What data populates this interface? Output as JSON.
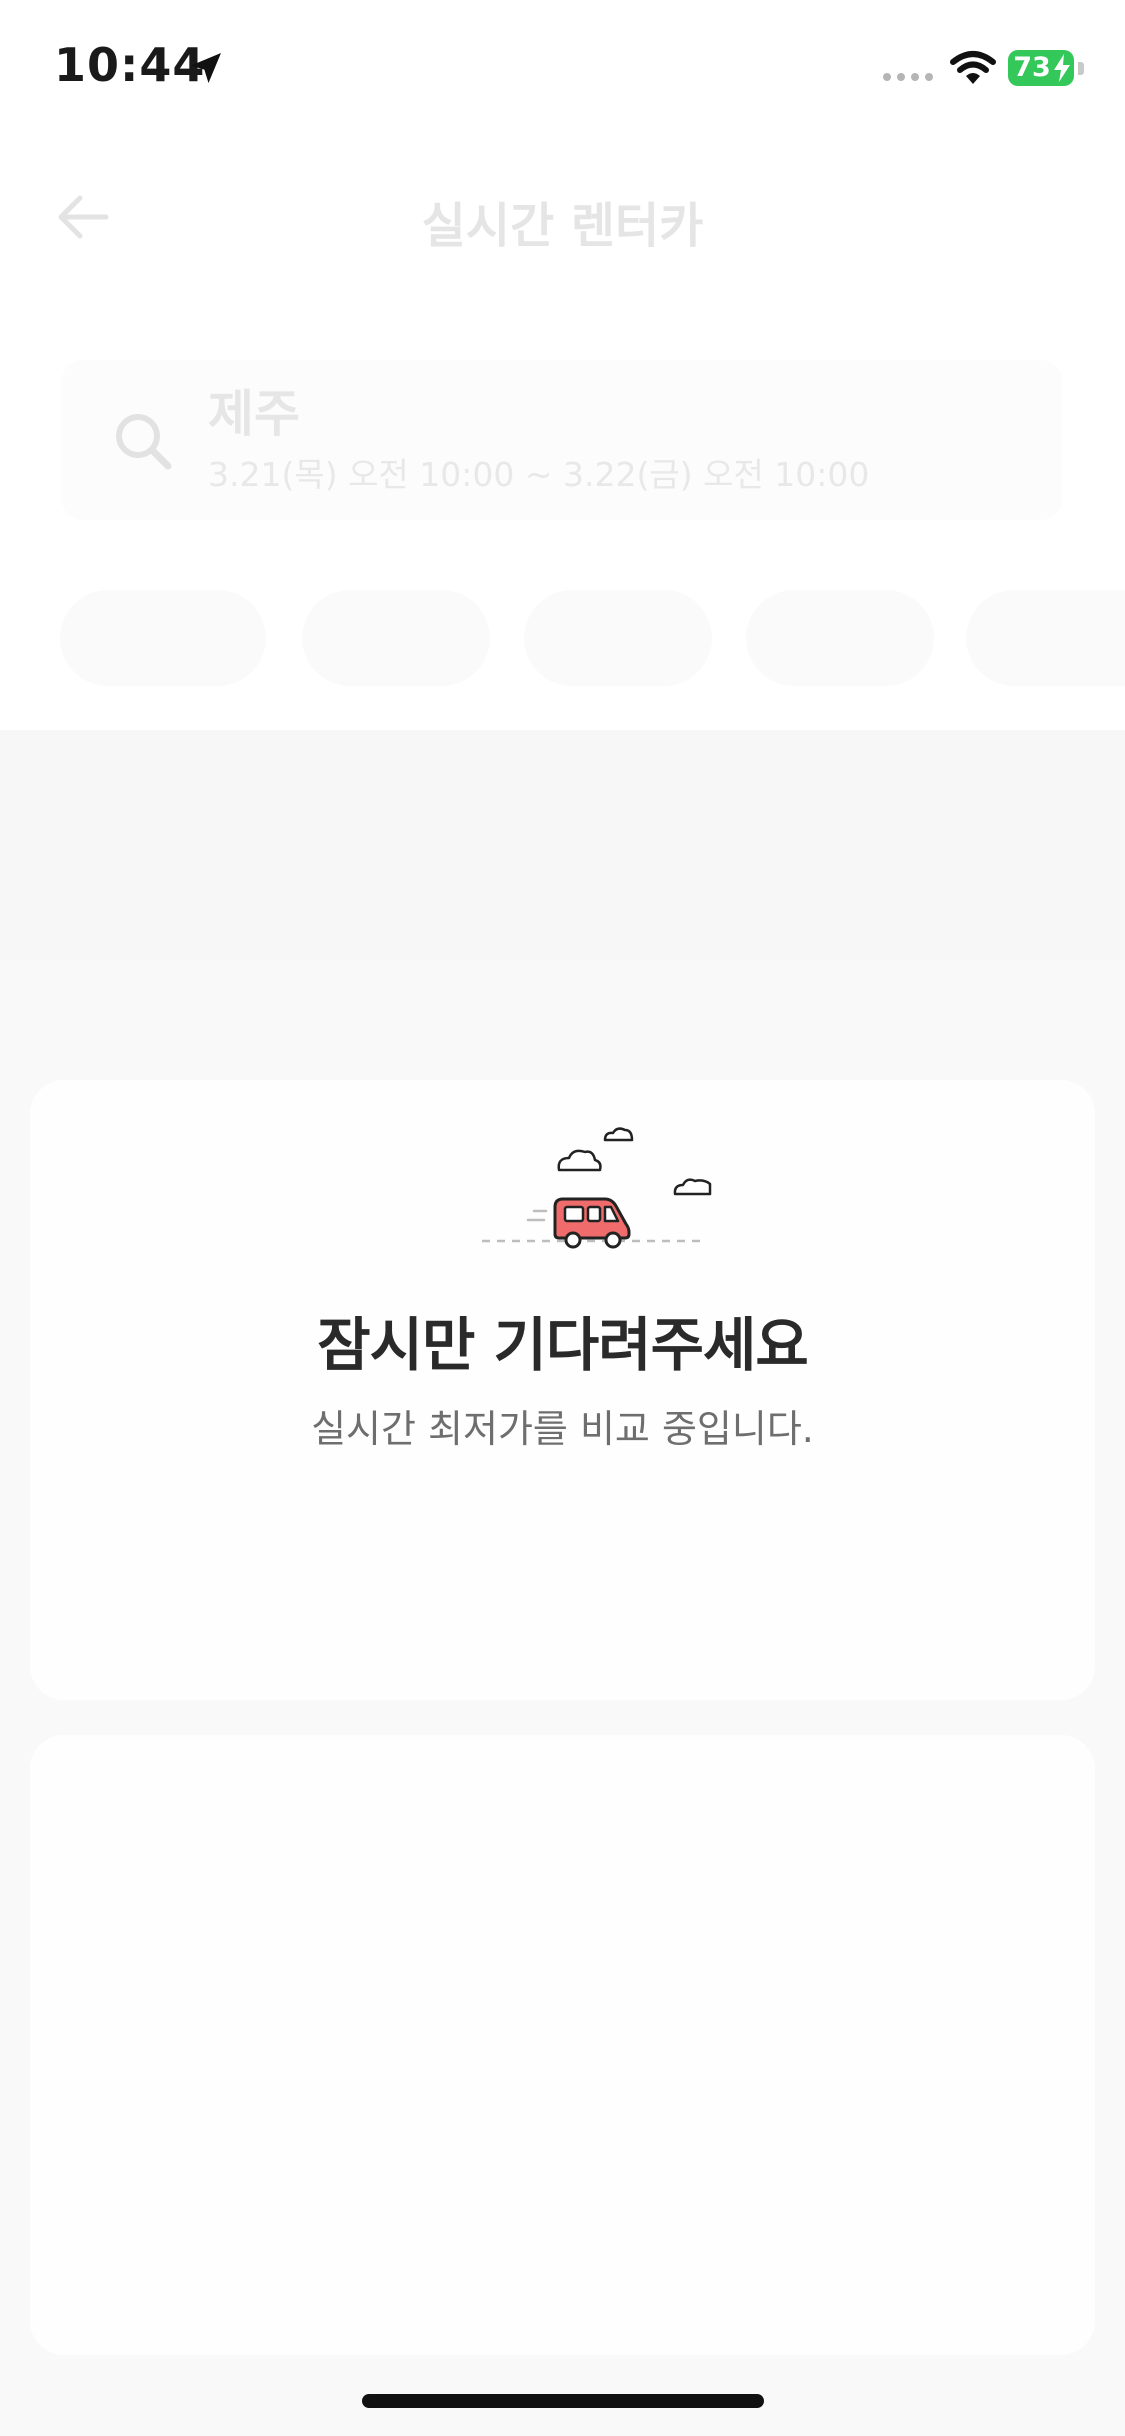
{
  "status_bar": {
    "time": "10:44",
    "battery_percent": "73",
    "icons": [
      "location-arrow-icon",
      "cellular-signal-icon",
      "wifi-icon",
      "battery-charging-icon"
    ],
    "battery_color": "#34c759"
  },
  "header": {
    "title": "실시간 렌터카",
    "back_icon": "arrow-left-icon"
  },
  "search": {
    "location": "제주",
    "dates": "3.21(목) 오전 10:00 ~ 3.22(금) 오전 10:00",
    "icon": "search-icon"
  },
  "loading": {
    "title": "잠시만 기다려주세요",
    "subtitle": "실시간 최저가를 비교 중입니다.",
    "illustration": "moving-van-illustration",
    "accent_color": "#f06b6b"
  }
}
